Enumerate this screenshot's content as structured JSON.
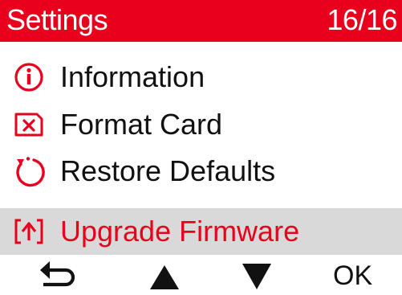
{
  "header": {
    "title": "Settings",
    "page_counter": "16/16"
  },
  "menu": {
    "items": [
      {
        "label": "Information",
        "icon": "info-icon"
      },
      {
        "label": "Format Card",
        "icon": "format-card-icon"
      },
      {
        "label": "Restore Defaults",
        "icon": "restore-icon"
      },
      {
        "label": "Upgrade Firmware",
        "icon": "upgrade-icon",
        "selected": true
      }
    ]
  },
  "softkeys": {
    "back_icon": "back-arrow-icon",
    "up_icon": "up-triangle-icon",
    "down_icon": "down-triangle-icon",
    "ok_label": "OK"
  },
  "colors": {
    "accent": "#e8001c",
    "selected_bg": "#d9d9d9",
    "text": "#111111"
  }
}
